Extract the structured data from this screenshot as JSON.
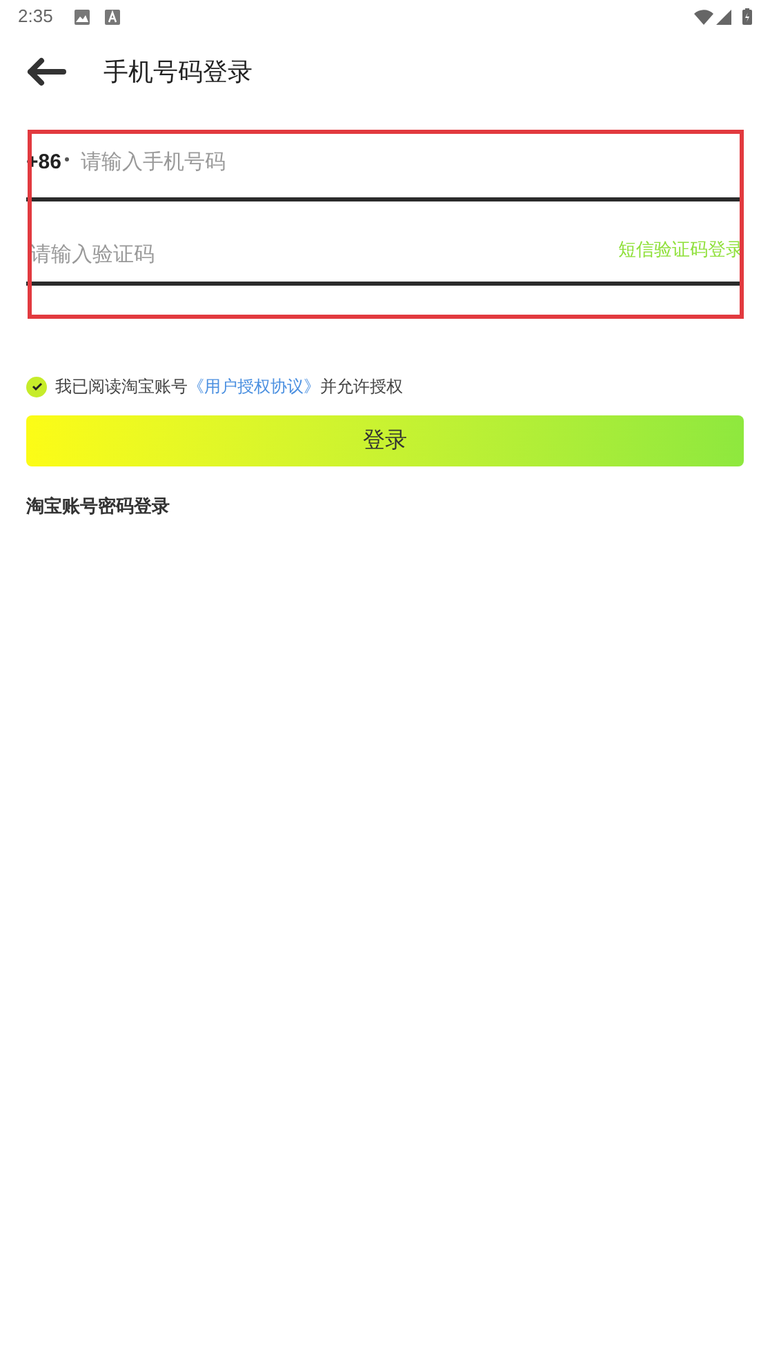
{
  "status_bar": {
    "time": "2:35"
  },
  "header": {
    "title": "手机号码登录"
  },
  "phone": {
    "country_code": "+86",
    "placeholder": "请输入手机号码"
  },
  "code": {
    "placeholder": "请输入验证码",
    "action": "短信验证码登录"
  },
  "agreement": {
    "checked": true,
    "before": "我已阅读淘宝账号",
    "link": "《用户授权协议》",
    "after": "并允许授权"
  },
  "login_button": "登录",
  "alt_login": "淘宝账号密码登录"
}
